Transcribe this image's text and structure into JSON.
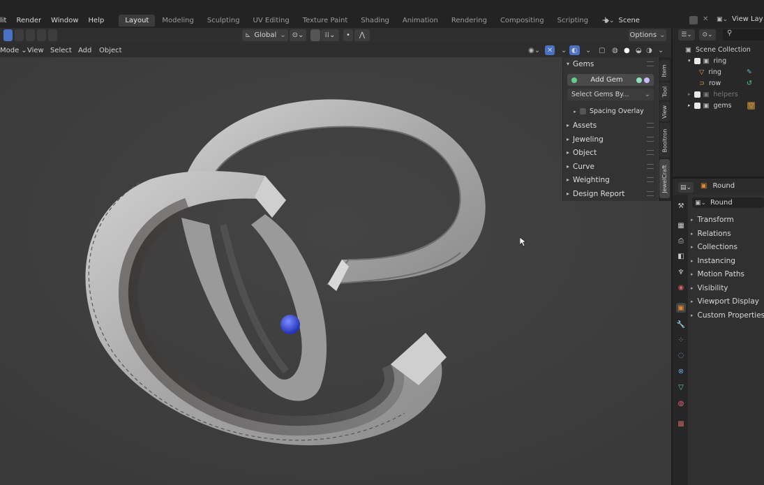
{
  "menus": [
    "lit",
    "Render",
    "Window",
    "Help"
  ],
  "workspace_tabs": [
    {
      "label": "Layout",
      "active": true
    },
    {
      "label": "Modeling"
    },
    {
      "label": "Sculpting"
    },
    {
      "label": "UV Editing"
    },
    {
      "label": "Texture Paint"
    },
    {
      "label": "Shading"
    },
    {
      "label": "Animation"
    },
    {
      "label": "Rendering"
    },
    {
      "label": "Compositing"
    },
    {
      "label": "Scripting"
    }
  ],
  "add_workspace": "+",
  "scene": {
    "label": "Scene",
    "view_layer": "View Lay"
  },
  "toolbar": {
    "transform_orientation": "Global",
    "options_label": "Options"
  },
  "view_header": {
    "mode": "Mode",
    "items": [
      "View",
      "Select",
      "Add",
      "Object"
    ]
  },
  "npanel": {
    "gems_header": "Gems",
    "add_gem": "Add Gem",
    "select_gems_by": "Select Gems By...",
    "spacing_overlay": "Spacing Overlay",
    "sections": [
      "Assets",
      "Jeweling",
      "Object",
      "Curve",
      "Weighting",
      "Design Report"
    ]
  },
  "side_tabs": [
    "Item",
    "Tool",
    "View",
    "Booltron",
    "JewelCraft"
  ],
  "outliner": {
    "collection": "Scene Collection",
    "rows": [
      {
        "name": "ring",
        "level": 1
      },
      {
        "name": "ring",
        "level": 2
      },
      {
        "name": "row",
        "level": 2
      },
      {
        "name": "helpers",
        "level": 1
      },
      {
        "name": "gems",
        "level": 1
      }
    ]
  },
  "properties": {
    "object_name": "Round",
    "data_name": "Round",
    "sections": [
      "Transform",
      "Relations",
      "Collections",
      "Instancing",
      "Motion Paths",
      "Visibility",
      "Viewport Display",
      "Custom Properties"
    ]
  },
  "colors": {
    "gem": "#3a4fd8",
    "accent_green": "#5fd08a",
    "ring": "#b9b9b9"
  }
}
